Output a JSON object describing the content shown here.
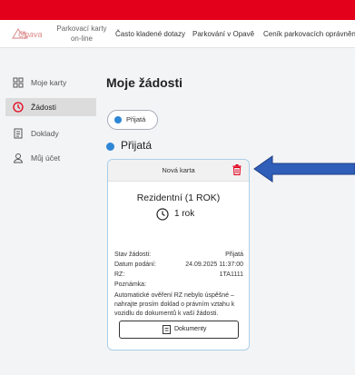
{
  "header": {
    "logo_text": "Opava",
    "brand_line1": "Parkovací karty",
    "brand_line2": "on-line",
    "nav": [
      {
        "label": "Často kladené dotazy"
      },
      {
        "label": "Parkování v Opavě"
      },
      {
        "label": "Ceník parkovacích oprávnění"
      }
    ]
  },
  "sidebar": {
    "items": [
      {
        "label": "Moje karty",
        "icon": "grid-icon",
        "active": false
      },
      {
        "label": "Žádosti",
        "icon": "clock-icon",
        "active": true
      },
      {
        "label": "Doklady",
        "icon": "document-icon",
        "active": false
      },
      {
        "label": "Můj účet",
        "icon": "user-icon",
        "active": false
      }
    ]
  },
  "main": {
    "title": "Moje žádosti",
    "filter_pill": "Přijatá",
    "section_title": "Přijatá"
  },
  "card": {
    "header_title": "Nová karta",
    "title": "Rezidentní (1 ROK)",
    "duration": "1 rok",
    "rows": [
      {
        "key": "Stav žádosti:",
        "value": "Přijatá"
      },
      {
        "key": "Datum podání:",
        "value": "24.09.2025 11:37:00"
      },
      {
        "key": "RZ:",
        "value": "1TA1111"
      }
    ],
    "note_label": "Poznámka:",
    "note_text": "Automatické ověření RZ nebylo úspěšné – nahrajte prosím doklad o právním vztahu k vozidlu do dokumentů k vaší žádosti.",
    "documents_button": "Dokumenty"
  },
  "colors": {
    "topbar": "#e3001b",
    "accent_blue": "#2d86d6",
    "delete_red": "#e3001b",
    "annotation_arrow": "#2f5fb8"
  }
}
